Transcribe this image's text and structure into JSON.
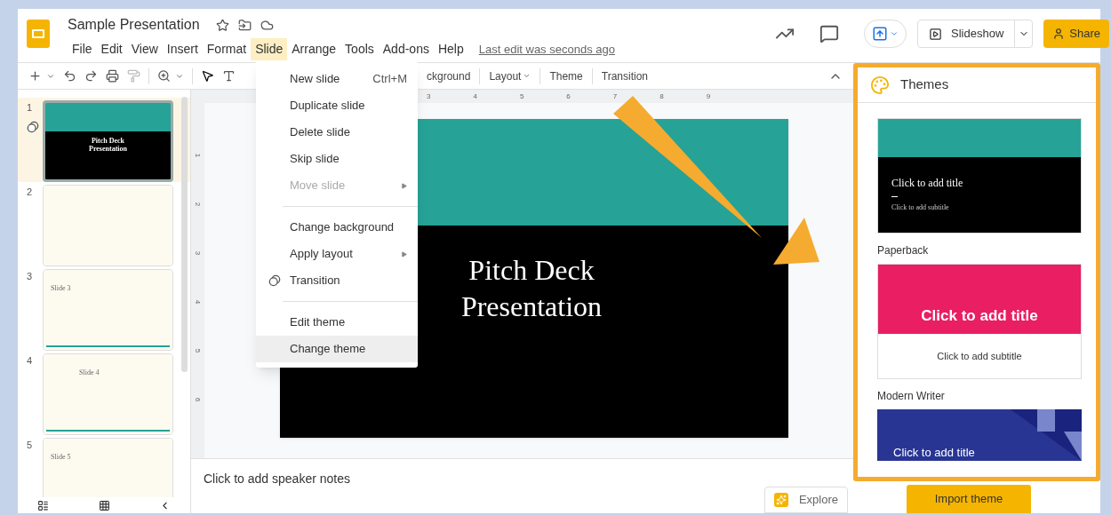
{
  "header": {
    "title": "Sample Presentation",
    "last_edit": "Last edit was seconds ago",
    "slideshow": "Slideshow",
    "share": "Share",
    "menus": [
      {
        "label": "File",
        "selected": false
      },
      {
        "label": "Edit",
        "selected": false
      },
      {
        "label": "View",
        "selected": false
      },
      {
        "label": "Insert",
        "selected": false
      },
      {
        "label": "Format",
        "selected": false
      },
      {
        "label": "Slide",
        "selected": true
      },
      {
        "label": "Arrange",
        "selected": false
      },
      {
        "label": "Tools",
        "selected": false
      },
      {
        "label": "Add-ons",
        "selected": false
      },
      {
        "label": "Help",
        "selected": false
      }
    ]
  },
  "toolbar": {
    "items": [
      {
        "label": "ckground",
        "kind": "button"
      },
      {
        "label": "Layout",
        "kind": "dropdown"
      },
      {
        "label": "Theme",
        "kind": "button"
      },
      {
        "label": "Transition",
        "kind": "button"
      }
    ]
  },
  "slide_menu": {
    "items": [
      {
        "kind": "item",
        "label": "New slide",
        "shortcut": "Ctrl+M",
        "disabled": false,
        "submenu": false,
        "icon": false,
        "highlighted": false
      },
      {
        "kind": "item",
        "label": "Duplicate slide",
        "disabled": false,
        "submenu": false,
        "icon": false,
        "highlighted": false
      },
      {
        "kind": "item",
        "label": "Delete slide",
        "disabled": false,
        "submenu": false,
        "icon": false,
        "highlighted": false
      },
      {
        "kind": "item",
        "label": "Skip slide",
        "disabled": false,
        "submenu": false,
        "icon": false,
        "highlighted": false
      },
      {
        "kind": "item",
        "label": "Move slide",
        "disabled": true,
        "submenu": true,
        "icon": false,
        "highlighted": false
      },
      {
        "kind": "divider"
      },
      {
        "kind": "item",
        "label": "Change background",
        "disabled": false,
        "submenu": false,
        "icon": false,
        "highlighted": false
      },
      {
        "kind": "item",
        "label": "Apply layout",
        "disabled": false,
        "submenu": true,
        "icon": false,
        "highlighted": false
      },
      {
        "kind": "item",
        "label": "Transition",
        "disabled": false,
        "submenu": false,
        "icon": true,
        "highlighted": false
      },
      {
        "kind": "divider"
      },
      {
        "kind": "item",
        "label": "Edit theme",
        "disabled": false,
        "submenu": false,
        "icon": false,
        "highlighted": false
      },
      {
        "kind": "item",
        "label": "Change theme",
        "disabled": false,
        "submenu": false,
        "icon": false,
        "highlighted": true
      }
    ]
  },
  "filmstrip": {
    "slides": [
      {
        "number": "1",
        "selected": true,
        "transition": true,
        "kind": "title",
        "text": "Pitch Deck Presentation"
      },
      {
        "number": "2",
        "selected": false,
        "transition": false,
        "kind": "blank"
      },
      {
        "number": "3",
        "selected": false,
        "transition": false,
        "kind": "label",
        "text": "Slide 3"
      },
      {
        "number": "4",
        "selected": false,
        "transition": false,
        "kind": "centered",
        "text": "Slide 4"
      },
      {
        "number": "5",
        "selected": false,
        "transition": false,
        "kind": "label",
        "text": "Slide 5"
      }
    ]
  },
  "ruler": {
    "horizontal": [
      "3",
      "4",
      "5",
      "6",
      "7",
      "8",
      "9"
    ],
    "vertical": [
      "1",
      "2",
      "3",
      "4",
      "5",
      "6"
    ]
  },
  "slide": {
    "title": "Pitch Deck Presentation"
  },
  "notes": {
    "placeholder": "Click to add speaker notes"
  },
  "explore": "Explore",
  "themes": {
    "title": "Themes",
    "items": [
      {
        "kind": "teal",
        "title": "Click to add title",
        "subtitle": "Click to add subtitle"
      },
      {
        "name": "Paperback",
        "kind": "pink",
        "title": "Click to add title",
        "subtitle": "Click to add subtitle"
      },
      {
        "name": "Modern Writer",
        "kind": "blue",
        "title": "Click to add title"
      }
    ],
    "import_button": "Import theme"
  }
}
